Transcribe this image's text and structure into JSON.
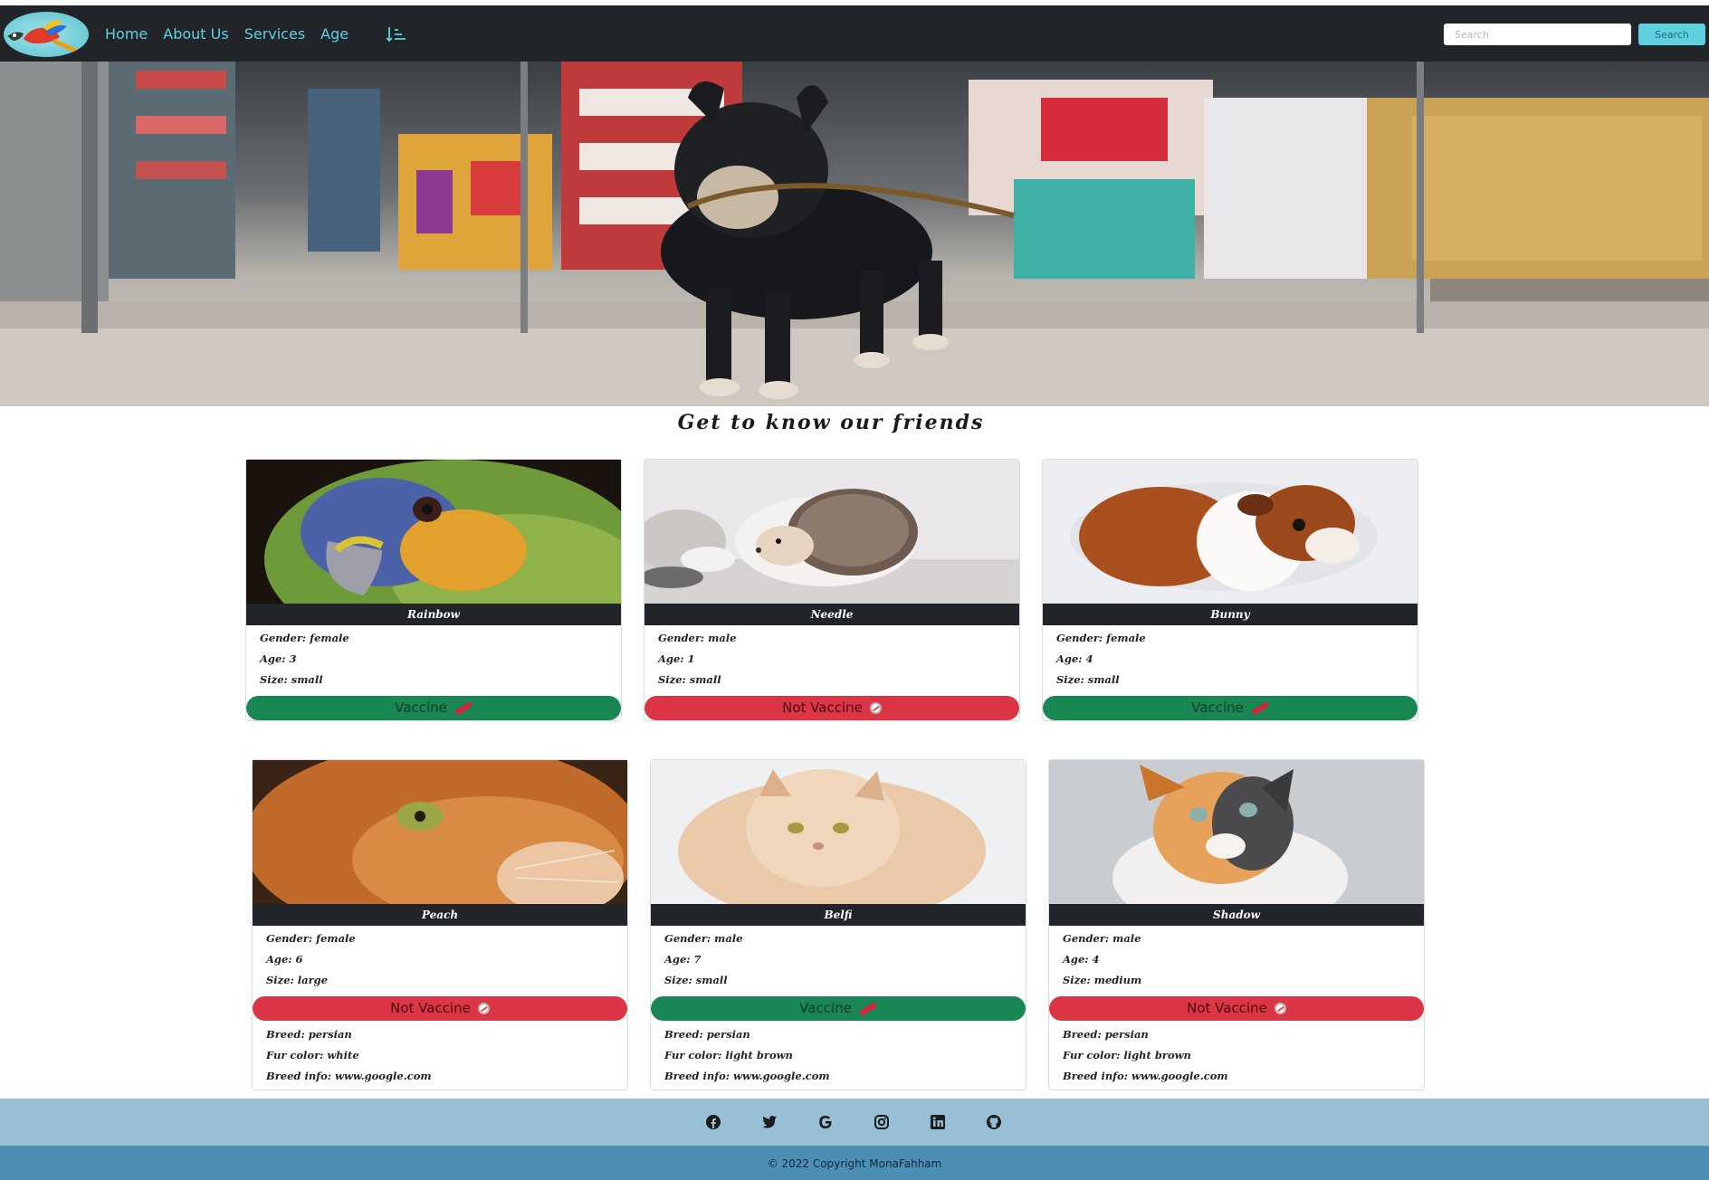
{
  "nav": {
    "links": [
      "Home",
      "About Us",
      "Services",
      "Age"
    ],
    "search_placeholder": "Search",
    "search_button": "Search"
  },
  "section_title": "Get to know our friends",
  "pets": [
    {
      "name": "Rainbow",
      "gender": "Gender: female",
      "age": "Age: 3",
      "size": "Size: small",
      "vaccine": "Vaccine",
      "vaccinated": true
    },
    {
      "name": "Needle",
      "gender": "Gender: male",
      "age": "Age: 1",
      "size": "Size: small",
      "vaccine": "Not Vaccine",
      "vaccinated": false
    },
    {
      "name": "Bunny",
      "gender": "Gender: female",
      "age": "Age: 4",
      "size": "Size: small",
      "vaccine": "Vaccine",
      "vaccinated": true
    },
    {
      "name": "Peach",
      "gender": "Gender: female",
      "age": "Age: 6",
      "size": "Size: large",
      "vaccine": "Not Vaccine",
      "vaccinated": false,
      "breed": "Breed: persian",
      "fur": "Fur color: white",
      "info": "Breed info: www.google.com"
    },
    {
      "name": "Belfi",
      "gender": "Gender: male",
      "age": "Age: 7",
      "size": "Size: small",
      "vaccine": "Vaccine",
      "vaccinated": true,
      "breed": "Breed: persian",
      "fur": "Fur color: light brown",
      "info": "Breed info: www.google.com"
    },
    {
      "name": "Shadow",
      "gender": "Gender: male",
      "age": "Age: 4",
      "size": "Size: medium",
      "vaccine": "Not Vaccine",
      "vaccinated": false,
      "breed": "Breed: persian",
      "fur": "Fur color: light brown",
      "info": "Breed info: www.google.com"
    }
  ],
  "footer": {
    "social_icons": [
      "facebook-icon",
      "twitter-icon",
      "google-icon",
      "instagram-icon",
      "linkedin-icon",
      "github-icon"
    ],
    "copyright": "© 2022 Copyright MonaFahham"
  },
  "colors": {
    "navbar": "#212529",
    "accent": "#5fd0e0",
    "vaccine_green": "#198754",
    "not_vaccine_red": "#dc3545",
    "footer_top": "#97bfd6",
    "footer_bottom": "#4b8fb4"
  }
}
